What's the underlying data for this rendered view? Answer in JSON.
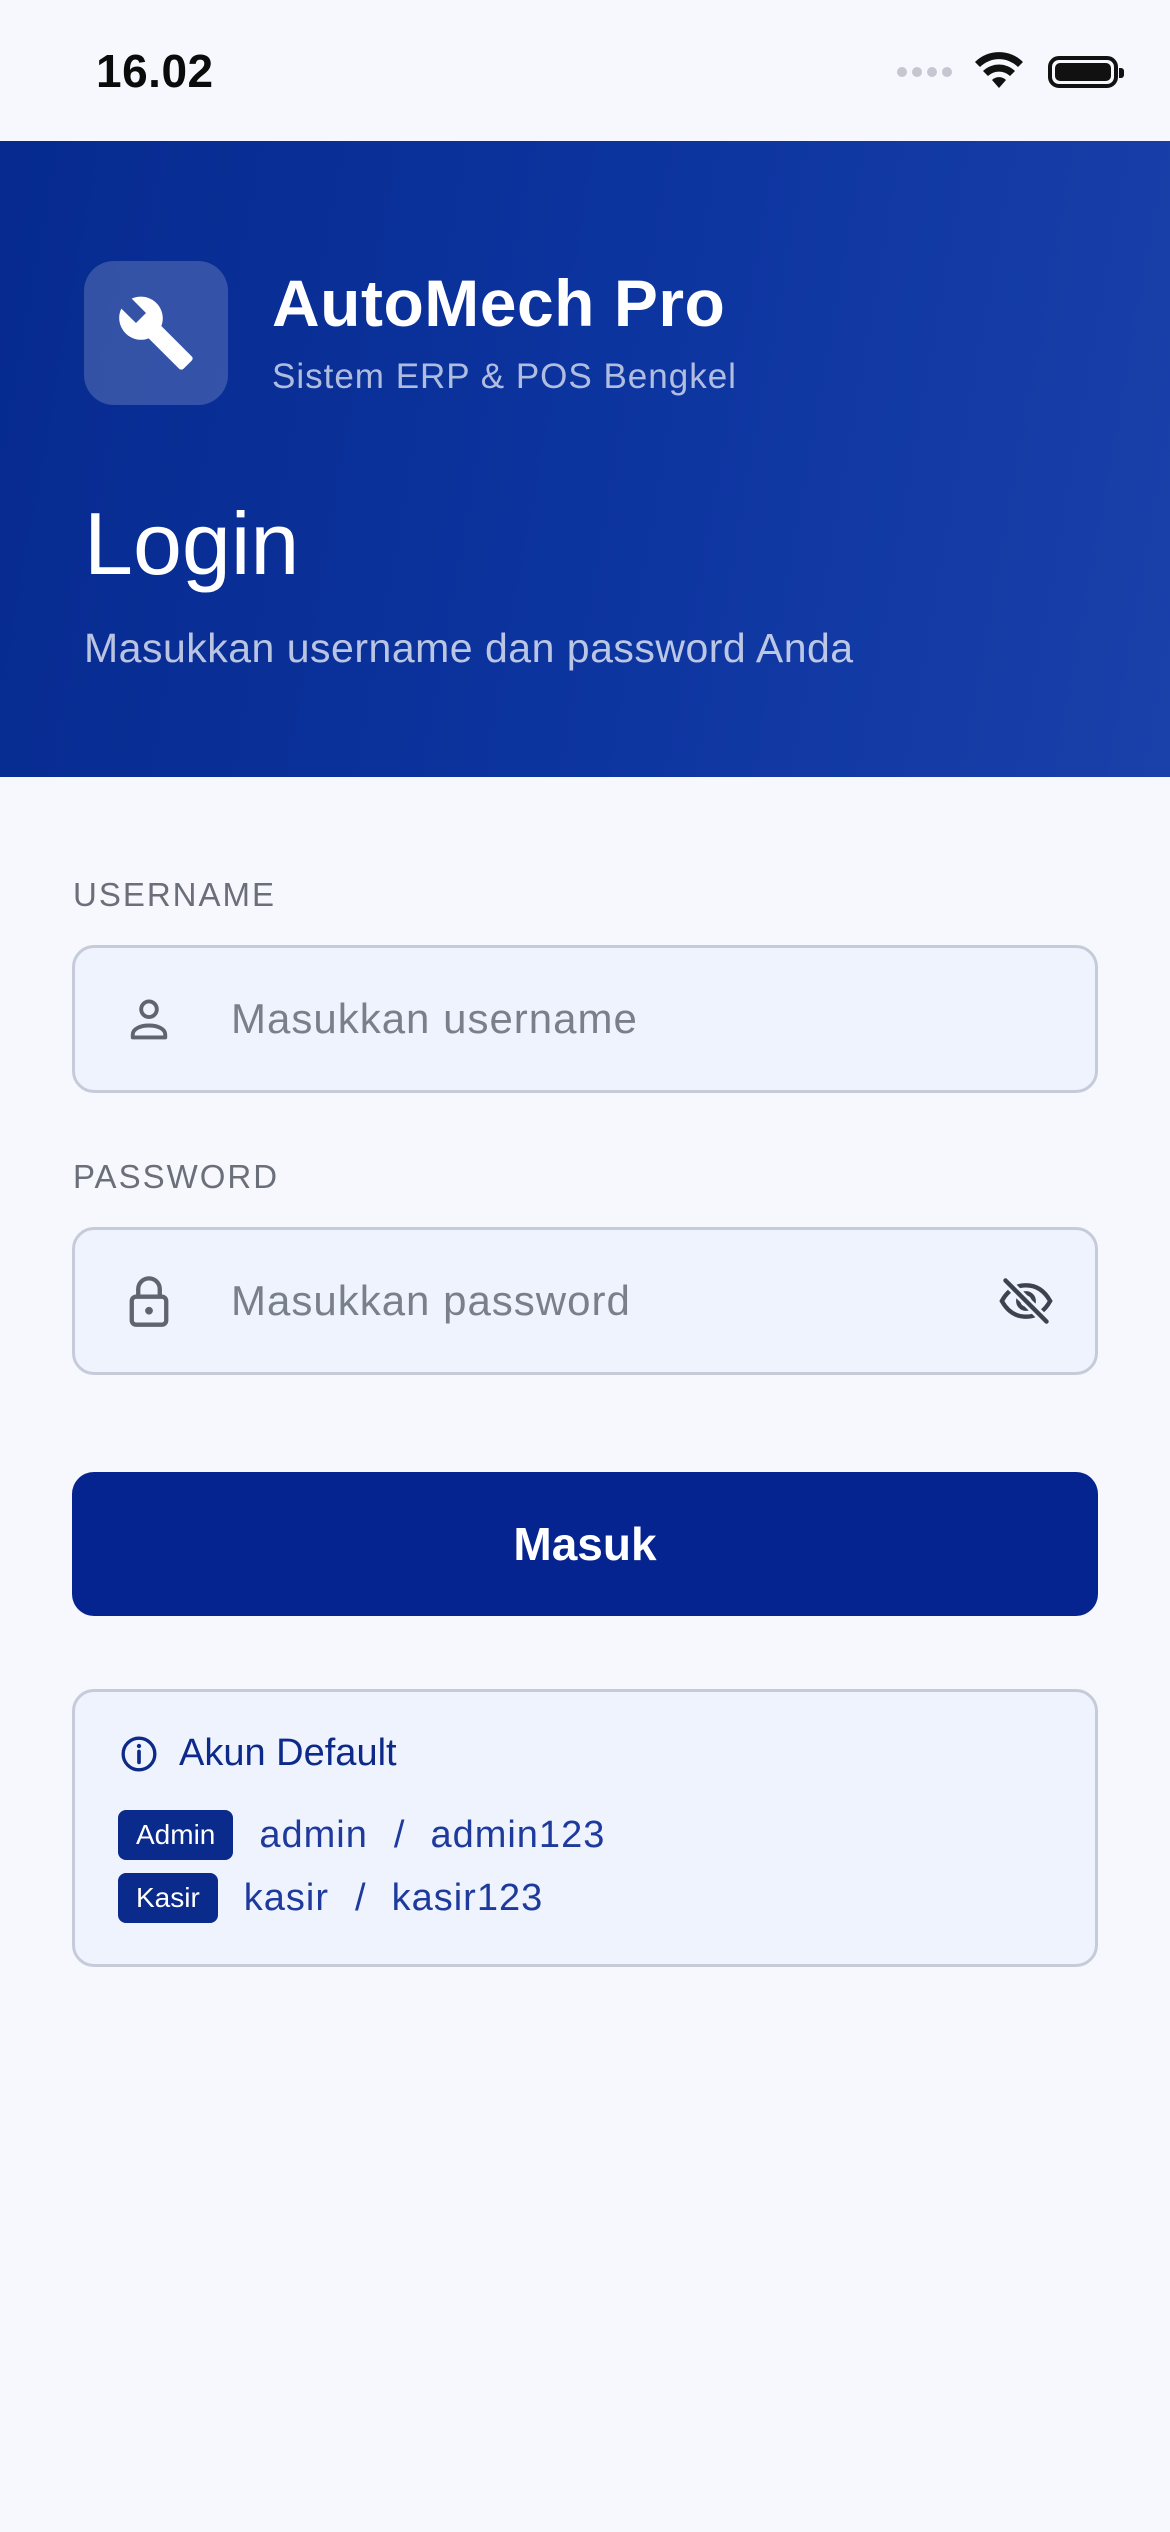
{
  "status_bar": {
    "time": "16.02"
  },
  "header": {
    "app_name": "AutoMech Pro",
    "app_tagline": "Sistem ERP & POS Bengkel",
    "title": "Login",
    "subtitle": "Masukkan username dan password Anda"
  },
  "form": {
    "username_label": "USERNAME",
    "username_placeholder": "Masukkan username",
    "password_label": "PASSWORD",
    "password_placeholder": "Masukkan password",
    "submit_label": "Masuk"
  },
  "default_accounts": {
    "title": "Akun Default",
    "accounts": [
      {
        "role": "Admin",
        "username": "admin",
        "separator": "/",
        "password": "admin123"
      },
      {
        "role": "Kasir",
        "username": "kasir",
        "separator": "/",
        "password": "kasir123"
      }
    ]
  },
  "colors": {
    "primary": "#05248f",
    "hero_start": "#062a8f",
    "hero_end": "#1a40aa",
    "background": "#f6f8fd",
    "field_bg": "#eef3fd",
    "field_border": "#c6cbd9"
  },
  "icons": {
    "logo": "wrench-icon",
    "username": "user-icon",
    "password": "lock-icon",
    "toggle_password": "eye-off-icon",
    "info": "info-icon"
  }
}
